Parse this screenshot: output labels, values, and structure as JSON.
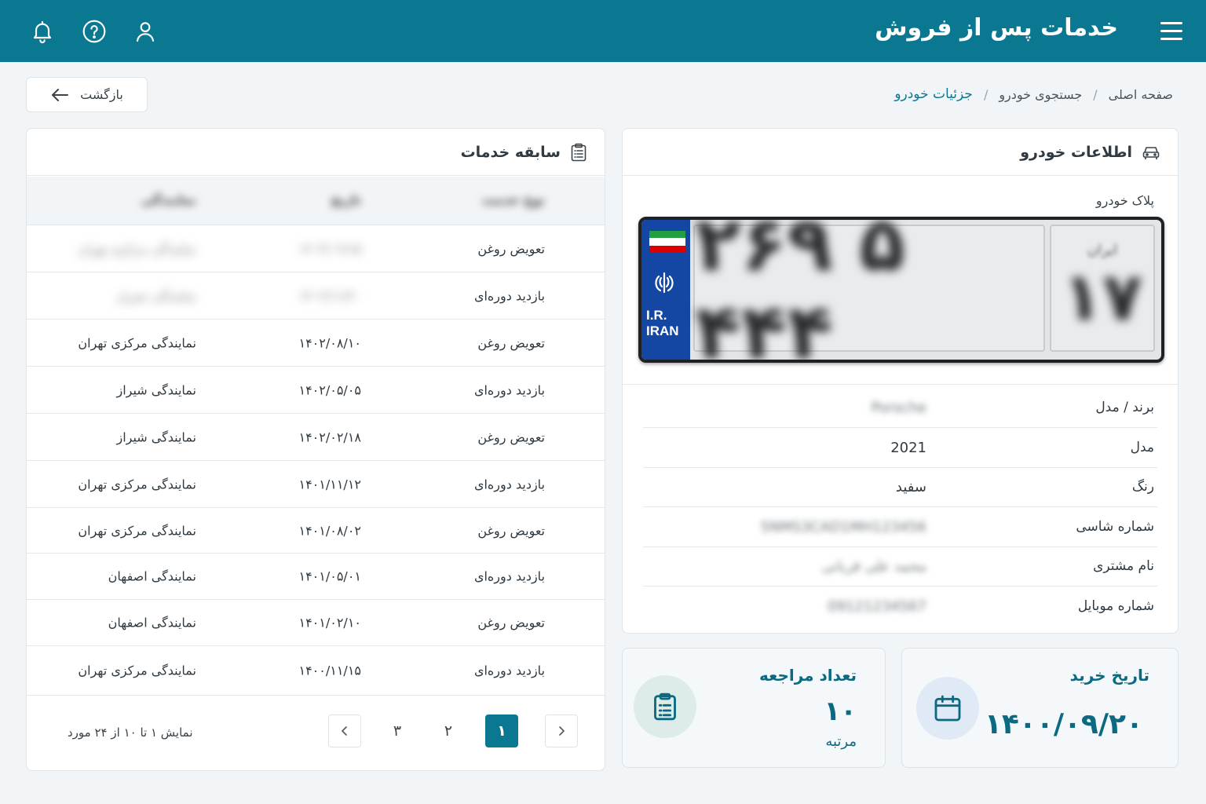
{
  "header": {
    "title": "خدمات پس از فروش",
    "icons": [
      "bell-icon",
      "help-icon",
      "user-icon",
      "menu-icon"
    ]
  },
  "breadcrumb": {
    "items": [
      "صفحه اصلی",
      "جستجوی خودرو",
      "جزئیات خودرو"
    ],
    "separator": "/"
  },
  "back_button": {
    "label": "بازگشت"
  },
  "vehicle": {
    "title": "اطلاعات خودرو",
    "plate_label": "پلاک خودرو",
    "plate": {
      "number": "۲۶۹ ۵ ۴۴۴",
      "region_word": "ایران",
      "region": "۱۷",
      "country_line1": "I.R.",
      "country_line2": "IRAN"
    },
    "rows": [
      {
        "label": "برند / مدل",
        "value": "Porsche",
        "blurred": true
      },
      {
        "label": "مدل",
        "value": "2021",
        "blurred": false
      },
      {
        "label": "رنگ",
        "value": "سفید",
        "blurred": false
      },
      {
        "label": "شماره شاسی",
        "value": "5NMS3CAD1MH123456",
        "blurred": true
      },
      {
        "label": "نام مشتری",
        "value": "محمد علی قربانی",
        "blurred": true
      },
      {
        "label": "شماره موبایل",
        "value": "09121234567",
        "blurred": true
      }
    ]
  },
  "stats": {
    "purchase": {
      "title": "تاریخ خرید",
      "value": "۱۴۰۰/۰۹/۲۰"
    },
    "visits": {
      "title": "تعداد مراجعه",
      "value": "۱۰",
      "unit": "مرتبه"
    }
  },
  "history": {
    "title": "سابقه خدمات",
    "columns": [
      "نوع خدمت",
      "تاریخ",
      "نمایندگی"
    ],
    "rows": [
      {
        "service": "تعویض روغن",
        "date": "۱۴۰۳/۰۲/۱۵",
        "place": "نمایندگی مرکزی تهران",
        "blurred": true
      },
      {
        "service": "بازدید دوره‌ای",
        "date": "۱۴۰۲/۱۱/۲۰",
        "place": "نمایندگی شیراز",
        "blurred": true
      },
      {
        "service": "تعویض روغن",
        "date": "۱۴۰۲/۰۸/۱۰",
        "place": "نمایندگی مرکزی تهران",
        "blurred": false
      },
      {
        "service": "بازدید دوره‌ای",
        "date": "۱۴۰۲/۰۵/۰۵",
        "place": "نمایندگی شیراز",
        "blurred": false
      },
      {
        "service": "تعویض روغن",
        "date": "۱۴۰۲/۰۲/۱۸",
        "place": "نمایندگی شیراز",
        "blurred": false
      },
      {
        "service": "بازدید دوره‌ای",
        "date": "۱۴۰۱/۱۱/۱۲",
        "place": "نمایندگی مرکزی تهران",
        "blurred": false
      },
      {
        "service": "تعویض روغن",
        "date": "۱۴۰۱/۰۸/۰۲",
        "place": "نمایندگی مرکزی تهران",
        "blurred": false
      },
      {
        "service": "بازدید دوره‌ای",
        "date": "۱۴۰۱/۰۵/۰۱",
        "place": "نمایندگی اصفهان",
        "blurred": false
      },
      {
        "service": "تعویض روغن",
        "date": "۱۴۰۱/۰۲/۱۰",
        "place": "نمایندگی اصفهان",
        "blurred": false
      },
      {
        "service": "بازدید دوره‌ای",
        "date": "۱۴۰۰/۱۱/۱۵",
        "place": "نمایندگی مرکزی تهران",
        "blurred": false
      }
    ],
    "pagination": {
      "pages": [
        "۱",
        "۲",
        "۳"
      ],
      "current": "۱",
      "info": "نمایش ۱ تا ۱۰ از ۲۴ مورد"
    }
  },
  "colors": {
    "primary": "#0b7892",
    "background": "#f2f5f7",
    "plate_blue": "#1447a3"
  }
}
